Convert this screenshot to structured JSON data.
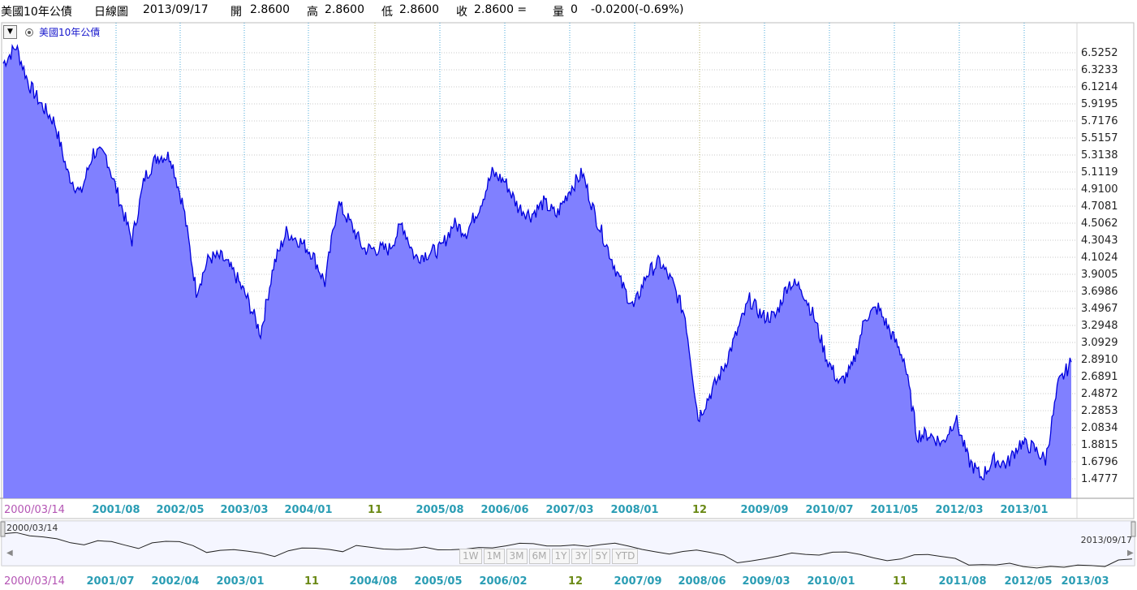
{
  "header": {
    "title": "美國10年公債",
    "period": "日線圖",
    "date": "2013/09/17",
    "open_label": "開",
    "open_value": "2.8600",
    "high_label": "高",
    "high_value": "2.8600",
    "low_label": "低",
    "low_value": "2.8600",
    "close_label": "收",
    "close_value": "2.8600 =",
    "volume_label": "量",
    "volume_value": "0",
    "change": "-0.0200(-0.69%)"
  },
  "legend": {
    "toggle": "▼",
    "series_name": "美國10年公債"
  },
  "navigator": {
    "start_label": "2000/03/14",
    "end_label": "2013/09/17",
    "left_arrow": "◀",
    "right_arrow": "▶",
    "range_buttons": [
      "1W",
      "1M",
      "3M",
      "6M",
      "1Y",
      "3Y",
      "5Y",
      "YTD"
    ],
    "x_labels": [
      "2000/03/14",
      "2001/07",
      "2002/04",
      "2003/01",
      "11",
      "2004/08",
      "2005/05",
      "2006/02",
      "12",
      "2007/09",
      "2008/06",
      "2009/03",
      "2010/01",
      "11",
      "2011/08",
      "2012/05",
      "2013/03"
    ]
  },
  "colors": {
    "area_fill": "#8080ff",
    "line": "#0000dd",
    "axis_label": "#2a9db4",
    "year_label": "#6b8a17",
    "start_label": "#b455b4"
  },
  "chart_data": {
    "type": "area",
    "ylabel": "",
    "ylim": [
      1.3,
      6.9
    ],
    "y_ticks": [
      "6.5252",
      "6.3233",
      "6.1214",
      "5.9195",
      "5.7176",
      "5.5157",
      "5.3138",
      "5.1119",
      "4.9100",
      "4.7081",
      "4.5062",
      "4.3043",
      "4.1024",
      "3.9005",
      "3.6986",
      "3.4967",
      "3.2948",
      "3.0929",
      "2.8910",
      "2.6891",
      "2.4872",
      "2.2853",
      "2.0834",
      "1.8815",
      "1.6796",
      "1.4777"
    ],
    "x_tick_labels": [
      "2000/03/14",
      "2001/08",
      "2002/05",
      "2003/03",
      "2004/01",
      "11",
      "2005/08",
      "2006/06",
      "2007/03",
      "2008/01",
      "12",
      "2009/09",
      "2010/07",
      "2011/05",
      "2012/03",
      "2013/01"
    ],
    "x": [
      "2000/03/14",
      "2000/05",
      "2000/07",
      "2000/09",
      "2000/11",
      "2001/01",
      "2001/03",
      "2001/05",
      "2001/07",
      "2001/09",
      "2001/11",
      "2002/01",
      "2002/03",
      "2002/05",
      "2002/07",
      "2002/09",
      "2002/11",
      "2003/01",
      "2003/03",
      "2003/05",
      "2003/06",
      "2003/07",
      "2003/09",
      "2003/11",
      "2004/01",
      "2004/03",
      "2004/05",
      "2004/07",
      "2004/09",
      "2004/11",
      "2005/01",
      "2005/03",
      "2005/05",
      "2005/07",
      "2005/09",
      "2005/11",
      "2006/01",
      "2006/03",
      "2006/05",
      "2006/07",
      "2006/09",
      "2006/11",
      "2007/01",
      "2007/03",
      "2007/05",
      "2007/07",
      "2007/09",
      "2007/11",
      "2008/01",
      "2008/03",
      "2008/05",
      "2008/07",
      "2008/09",
      "2008/11",
      "2008/12",
      "2009/01",
      "2009/03",
      "2009/05",
      "2009/07",
      "2009/09",
      "2009/11",
      "2010/01",
      "2010/03",
      "2010/05",
      "2010/07",
      "2010/09",
      "2010/11",
      "2011/01",
      "2011/03",
      "2011/05",
      "2011/07",
      "2011/09",
      "2011/11",
      "2012/01",
      "2012/03",
      "2012/05",
      "2012/07",
      "2012/09",
      "2012/11",
      "2013/01",
      "2013/03",
      "2013/05",
      "2013/07",
      "2013/09/17"
    ],
    "series": [
      {
        "values": [
          6.4,
          6.6,
          6.15,
          5.9,
          5.7,
          5.1,
          4.85,
          5.35,
          5.3,
          4.8,
          4.3,
          5.05,
          5.3,
          5.3,
          4.7,
          3.7,
          4.1,
          4.1,
          3.9,
          3.6,
          3.2,
          4.0,
          4.4,
          4.3,
          4.15,
          3.8,
          4.75,
          4.5,
          4.2,
          4.2,
          4.2,
          4.5,
          4.1,
          4.15,
          4.2,
          4.5,
          4.4,
          4.7,
          5.1,
          5.0,
          4.7,
          4.6,
          4.75,
          4.6,
          4.9,
          5.1,
          4.6,
          4.2,
          3.8,
          3.5,
          3.9,
          4.05,
          3.8,
          3.4,
          2.2,
          2.5,
          2.8,
          3.2,
          3.6,
          3.4,
          3.4,
          3.8,
          3.75,
          3.4,
          2.9,
          2.6,
          2.8,
          3.4,
          3.5,
          3.2,
          2.9,
          2.0,
          2.0,
          1.9,
          2.2,
          1.7,
          1.5,
          1.7,
          1.65,
          1.9,
          1.85,
          1.7,
          2.6,
          2.86
        ]
      }
    ]
  }
}
